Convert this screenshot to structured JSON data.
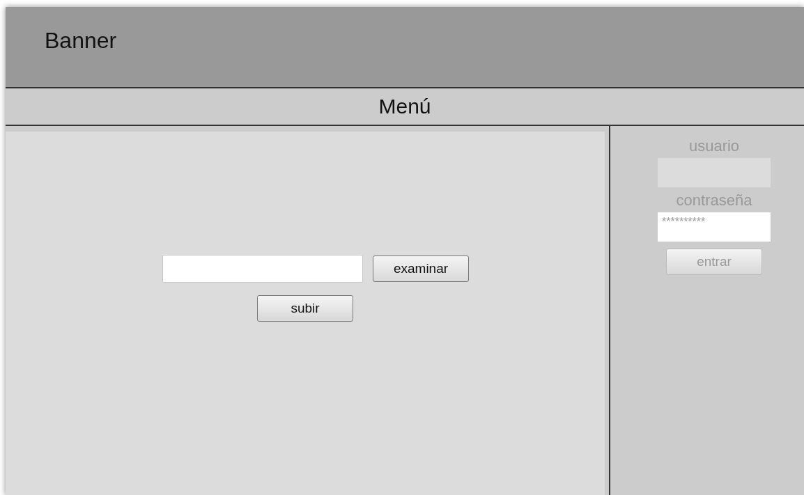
{
  "banner": {
    "title": "Banner"
  },
  "menu": {
    "title": "Menú"
  },
  "upload": {
    "browse_button": "examinar",
    "upload_button": "subir"
  },
  "login": {
    "disabled": true,
    "username_label": "usuario",
    "password_label": "contraseña",
    "password": {
      "value": "**********"
    },
    "submit_button": "entrar"
  }
}
